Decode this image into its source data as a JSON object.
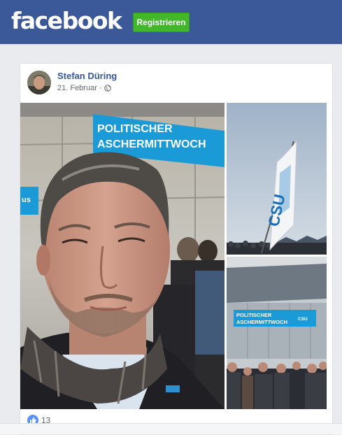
{
  "header": {
    "logo_text": "facebook",
    "register_label": "Registrieren"
  },
  "post": {
    "author_name": "Stefan Düring",
    "date": "21. Februar",
    "separator": "·",
    "privacy_icon": "globe-icon",
    "like_count": "13",
    "like_icon": "thumbs-up-icon"
  },
  "photos": {
    "main_sign_line1": "POLITISCHER",
    "main_sign_line2": "ASCHERMITTWOCH",
    "main_left_sign": "us",
    "flag_text": "CSU",
    "br_sign_line1": "POLITISCHER",
    "br_sign_line2": "ASCHERMITTWOCH",
    "br_sign_logo": "CSU"
  },
  "colors": {
    "facebook_blue": "#3b5998",
    "register_green": "#42b72a",
    "link_blue": "#365899",
    "sign_blue": "#1a9ad6"
  }
}
